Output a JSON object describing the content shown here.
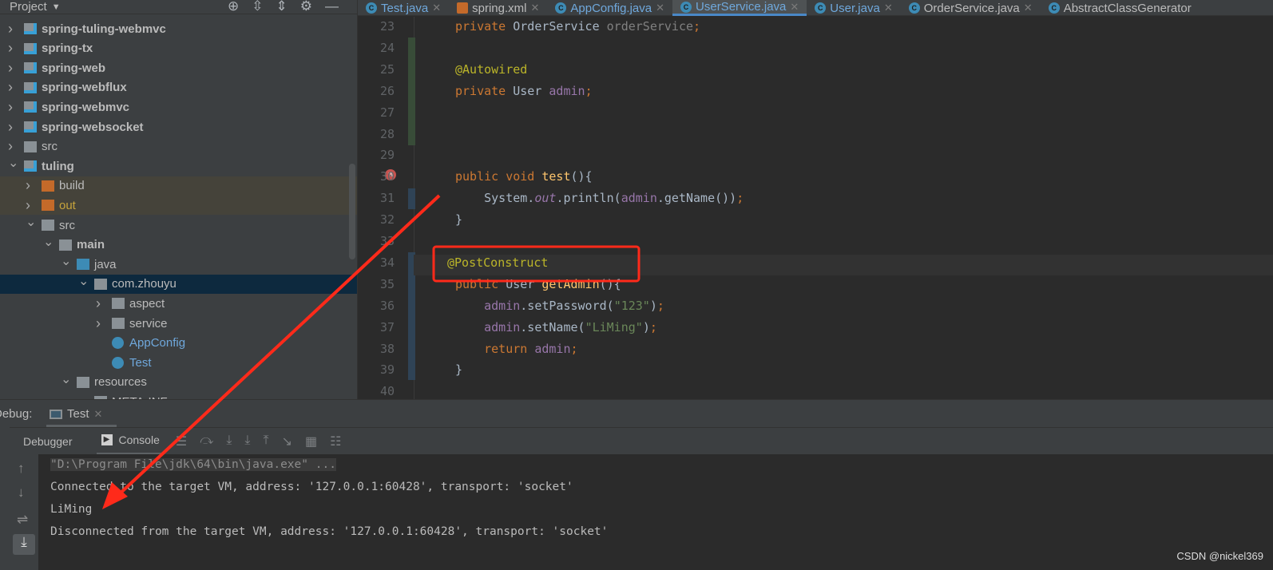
{
  "project": {
    "title": "Project",
    "items": [
      {
        "label": "spring-tuling-webmvc",
        "level": 0,
        "kind": "module",
        "bold": true,
        "open": false
      },
      {
        "label": "spring-tx",
        "level": 0,
        "kind": "module",
        "bold": true,
        "open": false
      },
      {
        "label": "spring-web",
        "level": 0,
        "kind": "module",
        "bold": true,
        "open": false
      },
      {
        "label": "spring-webflux",
        "level": 0,
        "kind": "module",
        "bold": true,
        "open": false
      },
      {
        "label": "spring-webmvc",
        "level": 0,
        "kind": "module",
        "bold": true,
        "open": false
      },
      {
        "label": "spring-websocket",
        "level": 0,
        "kind": "module",
        "bold": true,
        "open": false
      },
      {
        "label": "src",
        "level": 0,
        "kind": "folder",
        "open": false
      },
      {
        "label": "tuling",
        "level": 0,
        "kind": "module",
        "bold": true,
        "open": true
      },
      {
        "label": "build",
        "level": 1,
        "kind": "excluded",
        "open": false,
        "hl": true
      },
      {
        "label": "out",
        "level": 1,
        "kind": "excluded",
        "open": false,
        "hl": true,
        "color": "#c5a33c"
      },
      {
        "label": "src",
        "level": 1,
        "kind": "folder",
        "open": true
      },
      {
        "label": "main",
        "level": 2,
        "kind": "folder",
        "bold": true,
        "open": true
      },
      {
        "label": "java",
        "level": 3,
        "kind": "source",
        "open": true
      },
      {
        "label": "com.zhouyu",
        "level": 4,
        "kind": "package",
        "open": true,
        "selected": true
      },
      {
        "label": "aspect",
        "level": 5,
        "kind": "package",
        "open": false
      },
      {
        "label": "service",
        "level": 5,
        "kind": "package",
        "open": false
      },
      {
        "label": "AppConfig",
        "level": 5,
        "kind": "class",
        "color": "#6fa8dc"
      },
      {
        "label": "Test",
        "level": 5,
        "kind": "class",
        "color": "#6fa8dc"
      },
      {
        "label": "resources",
        "level": 3,
        "kind": "resources",
        "open": true
      },
      {
        "label": "META-INF",
        "level": 4,
        "kind": "folder",
        "open": false
      }
    ]
  },
  "tabs": [
    {
      "label": "Test.java",
      "icon": "class-icon",
      "color": "#6fa8dc"
    },
    {
      "label": "spring.xml",
      "icon": "xml-icon",
      "color": "#bbbbbb"
    },
    {
      "label": "AppConfig.java",
      "icon": "class-icon",
      "color": "#6fa8dc"
    },
    {
      "label": "UserService.java",
      "icon": "class-icon",
      "color": "#6fa8dc",
      "active": true
    },
    {
      "label": "User.java",
      "icon": "class-icon",
      "color": "#6fa8dc"
    },
    {
      "label": "OrderService.java",
      "icon": "class-icon",
      "color": "#bbbbbb"
    },
    {
      "label": "AbstractClassGenerator",
      "icon": "class-icon",
      "color": "#bbbbbb"
    }
  ],
  "code": [
    {
      "n": "23",
      "t": [
        [
          "kw",
          "private "
        ],
        [
          "ty",
          "OrderService "
        ],
        [
          "dim",
          "orderService"
        ],
        [
          "kw",
          ";"
        ]
      ]
    },
    {
      "n": "24",
      "t": []
    },
    {
      "n": "25",
      "t": [
        [
          "an",
          "@Autowired"
        ]
      ]
    },
    {
      "n": "26",
      "t": [
        [
          "kw",
          "private "
        ],
        [
          "ty",
          "User "
        ],
        [
          "fd",
          "admin"
        ],
        [
          "kw",
          ";"
        ]
      ]
    },
    {
      "n": "27",
      "t": []
    },
    {
      "n": "28",
      "t": []
    },
    {
      "n": "29",
      "t": []
    },
    {
      "n": "30",
      "t": [
        [
          "kw",
          "public void "
        ],
        [
          "fn",
          "test"
        ],
        [
          "ty",
          "(){"
        ]
      ]
    },
    {
      "n": "31",
      "t": [
        [
          "ty",
          "    System."
        ],
        [
          "fd it",
          "out"
        ],
        [
          "ty",
          ".println("
        ],
        [
          "fd",
          "admin"
        ],
        [
          "ty",
          ".getName())"
        ],
        [
          "kw",
          ";"
        ]
      ]
    },
    {
      "n": "32",
      "t": [
        [
          "ty",
          "}"
        ]
      ]
    },
    {
      "n": "33",
      "t": []
    },
    {
      "n": "34",
      "t": [
        [
          "an",
          "@PostConstruct"
        ]
      ],
      "shift": true
    },
    {
      "n": "35",
      "t": [
        [
          "kw",
          "public "
        ],
        [
          "ty",
          "User "
        ],
        [
          "fn",
          "getAdmin"
        ],
        [
          "ty",
          "(){"
        ]
      ]
    },
    {
      "n": "36",
      "t": [
        [
          "fd",
          "    admin"
        ],
        [
          "ty",
          ".setPassword("
        ],
        [
          "st",
          "\"123\""
        ],
        [
          "ty",
          ")"
        ],
        [
          "kw",
          ";"
        ]
      ]
    },
    {
      "n": "37",
      "t": [
        [
          "fd",
          "    admin"
        ],
        [
          "ty",
          ".setName("
        ],
        [
          "st",
          "\"LiMing\""
        ],
        [
          "ty",
          ")"
        ],
        [
          "kw",
          ";"
        ]
      ]
    },
    {
      "n": "38",
      "t": [
        [
          "kw",
          "    return "
        ],
        [
          "fd",
          "admin"
        ],
        [
          "kw",
          ";"
        ]
      ]
    },
    {
      "n": "39",
      "t": [
        [
          "ty",
          "}"
        ]
      ]
    },
    {
      "n": "40",
      "t": []
    }
  ],
  "debug": {
    "label": "Debug:",
    "tab": "Test",
    "debugger": "Debugger",
    "console": "Console"
  },
  "console": [
    "\"D:\\Program File\\jdk\\64\\bin\\java.exe\" ...",
    "Connected to the target VM, address: '127.0.0.1:60428', transport: 'socket'",
    "LiMing",
    "Disconnected from the target VM, address: '127.0.0.1:60428', transport: 'socket'"
  ],
  "annotation_color": "#ff2a1a",
  "watermark": "CSDN @nickel369"
}
